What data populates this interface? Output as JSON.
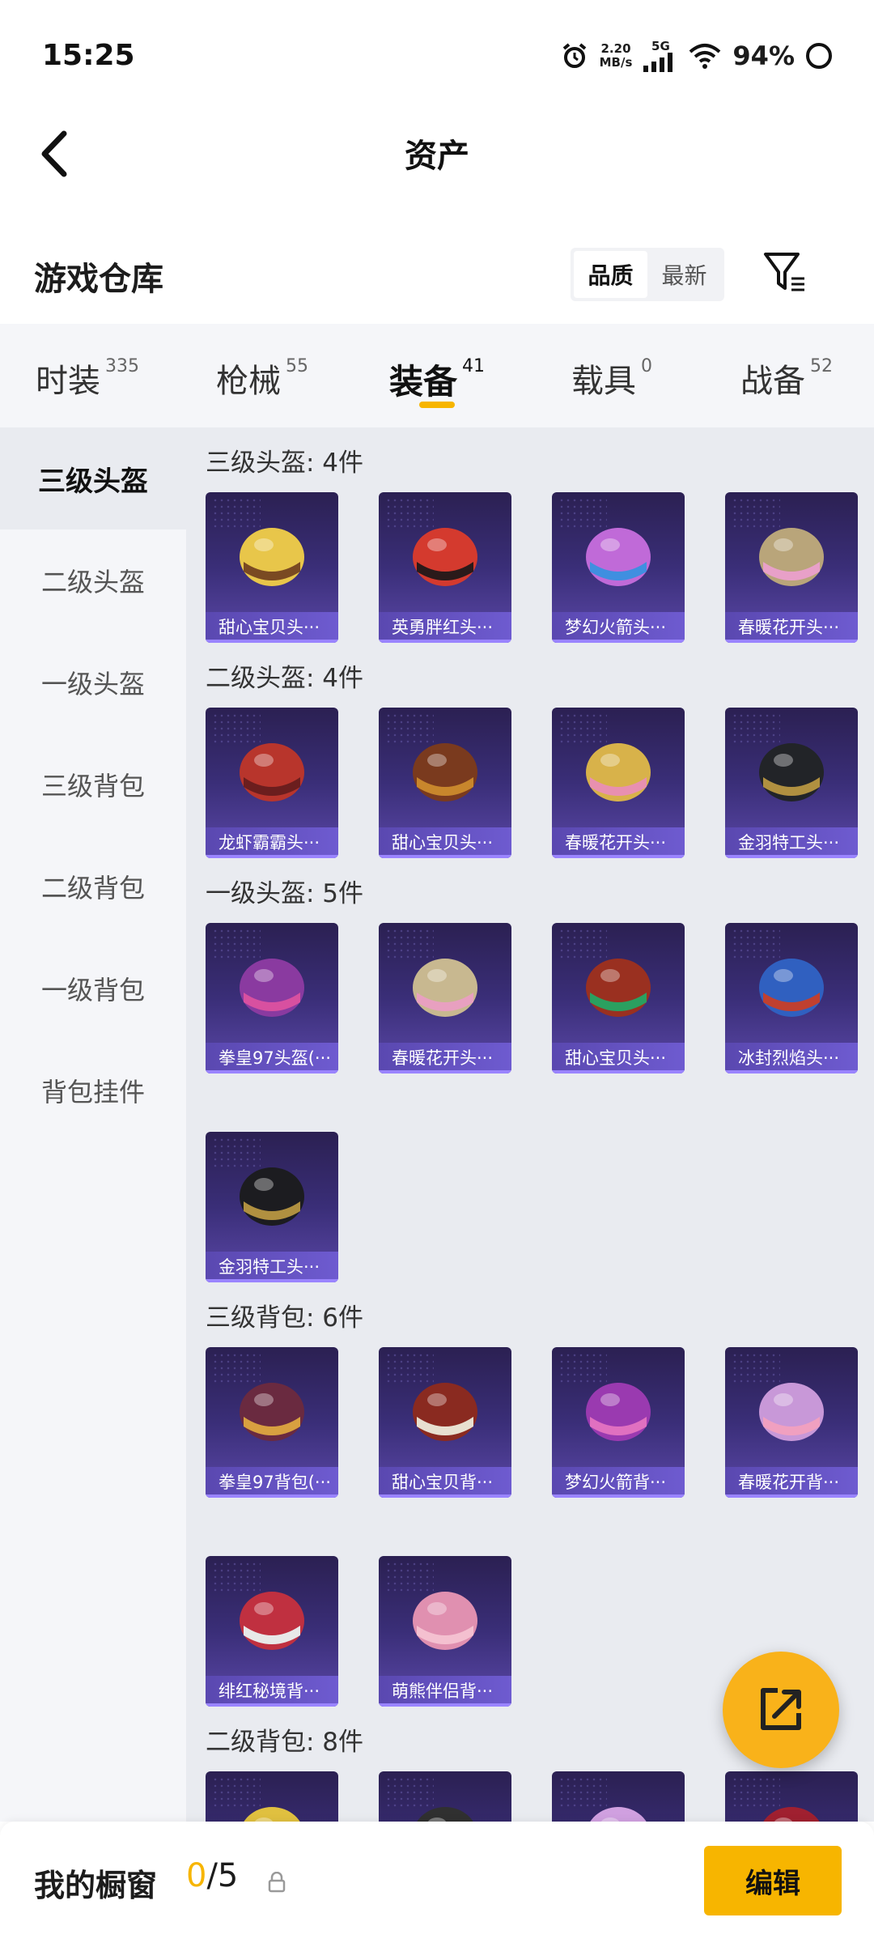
{
  "status_bar": {
    "time": "15:25",
    "speed_value": "2.20",
    "speed_unit": "MB/s",
    "network": "5G",
    "battery": "94%"
  },
  "header": {
    "title": "资产"
  },
  "warehouse": {
    "title": "游戏仓库",
    "sort_options": [
      "品质",
      "最新"
    ],
    "active_sort": "品质"
  },
  "tabs": [
    {
      "label": "时装",
      "count": "335"
    },
    {
      "label": "枪械",
      "count": "55"
    },
    {
      "label": "装备",
      "count": "41"
    },
    {
      "label": "载具",
      "count": "0"
    },
    {
      "label": "战备",
      "count": "52"
    }
  ],
  "active_tab": "装备",
  "sidebar": {
    "items": [
      "三级头盔",
      "二级头盔",
      "一级头盔",
      "三级背包",
      "二级背包",
      "一级背包",
      "背包挂件"
    ],
    "active": "三级头盔"
  },
  "sections": [
    {
      "title": "三级头盔: 4件",
      "items": [
        "甜心宝贝头···",
        "英勇胖红头···",
        "梦幻火箭头···",
        "春暖花开头···"
      ]
    },
    {
      "title": "二级头盔: 4件",
      "items": [
        "龙虾霸霸头···",
        "甜心宝贝头···",
        "春暖花开头···",
        "金羽特工头···"
      ]
    },
    {
      "title": "一级头盔: 5件",
      "items": [
        "拳皇97头盔(···",
        "春暖花开头···",
        "甜心宝贝头···",
        "冰封烈焰头···",
        "金羽特工头···"
      ]
    },
    {
      "title": "三级背包: 6件",
      "items": [
        "拳皇97背包(···",
        "甜心宝贝背···",
        "梦幻火箭背···",
        "春暖花开背···",
        "绯红秘境背···",
        "萌熊伴侣背···"
      ]
    },
    {
      "title": "二级背包: 8件",
      "items": [
        "",
        "",
        "",
        ""
      ]
    }
  ],
  "bottom_bar": {
    "title": "我的橱窗",
    "count_current": "0",
    "count_total": "/5",
    "edit_label": "编辑"
  },
  "colors": {
    "accent": "#f7b500",
    "card_bg": "#3a2e78",
    "card_label": "#6e5bd0"
  }
}
